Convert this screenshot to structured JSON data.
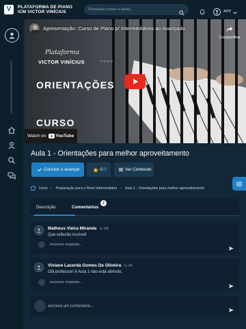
{
  "brand": {
    "logo": "V",
    "line1": "PLATAFORMA DE PIANO",
    "line2": "ICM VICTOR VINÍCIUS"
  },
  "search": {
    "placeholder": "Pesquisar cursos e aulas..."
  },
  "user": {
    "label": "APP"
  },
  "video": {
    "title": "Apresentação: Curso de Piano p/ Intermediários ao Avançado",
    "share_label": "Compartilhar",
    "script_text": "Plataforma",
    "artist": "VICTOR VINÍCIUS",
    "dots": "○○○○",
    "headline": "ORIENTAÇÕES",
    "subheadline": "CURSO",
    "watch_on": "Watch on",
    "youtube": "YouTube"
  },
  "lesson": {
    "title": "Aula 1 - Orientações para melhor aproveitamento",
    "complete_label": "Concluir e avançar",
    "rating_value": "0",
    "rating_suffix": "/5",
    "content_label": "Ver Conteúdo"
  },
  "breadcrumb": [
    "Início",
    "Preparação para o Nível Intermediário",
    "Aula 1 - Orientações para melhor aproveitamento"
  ],
  "tabs": {
    "description": "Descrição",
    "comments": "Comentários",
    "comments_count": "2"
  },
  "comments": [
    {
      "author": "Matheus Vieira Miranda",
      "time": "2M",
      "text": "Que reflexão incrível!",
      "reply_placeholder": "escrever resposta..."
    },
    {
      "author": "Viviane Lacerda Gomes De Oliveira",
      "time": "2A",
      "text": "Olá professor! A Aula 1 não está abrindo.",
      "reply_placeholder": "escrever resposta..."
    }
  ],
  "new_comment": {
    "placeholder": "escreva um comentário..."
  },
  "colors": {
    "background": "#122738",
    "panel": "#0f2130",
    "accent": "#1f7fc4",
    "play": "#e8291b",
    "star": "#f5c518"
  },
  "icons": [
    "logo-icon",
    "search-icon",
    "bell-icon",
    "user-icon",
    "chevron-down-icon",
    "home-icon",
    "user-icon",
    "search-icon",
    "chat-icon",
    "share-icon",
    "play-icon",
    "youtube-icon",
    "check-icon",
    "star-icon",
    "list-icon",
    "menu-icon",
    "send-icon"
  ]
}
